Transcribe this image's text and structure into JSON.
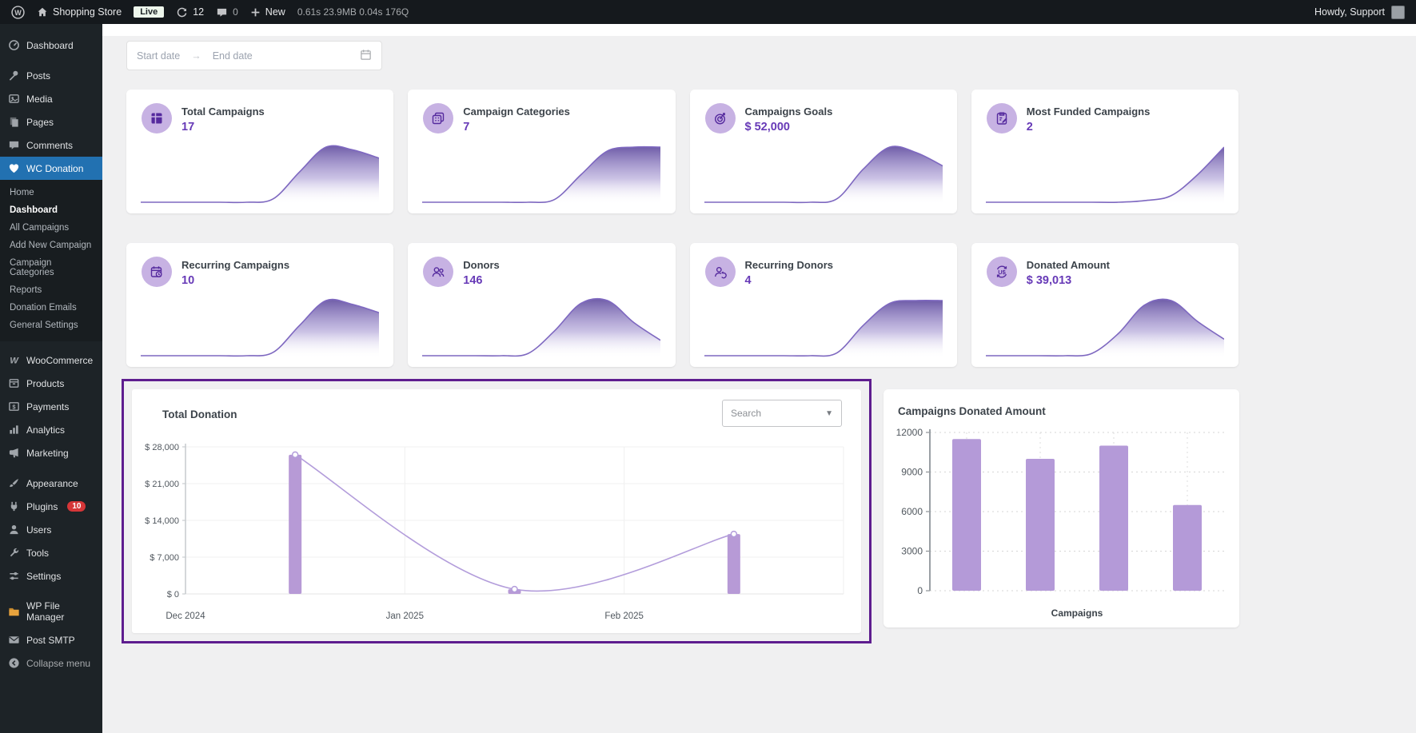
{
  "admin_bar": {
    "site_name": "Shopping Store",
    "live_badge": "Live",
    "update_count": "12",
    "comment_count": "0",
    "new_label": "New",
    "perf_stats": "0.61s 23.9MB 0.04s 176Q",
    "howdy": "Howdy, Support"
  },
  "sidebar": {
    "items": [
      {
        "label": "Dashboard"
      },
      {
        "label": "Posts"
      },
      {
        "label": "Media"
      },
      {
        "label": "Pages"
      },
      {
        "label": "Comments"
      },
      {
        "label": "WC Donation"
      },
      {
        "label": "WooCommerce"
      },
      {
        "label": "Products"
      },
      {
        "label": "Payments"
      },
      {
        "label": "Analytics"
      },
      {
        "label": "Marketing"
      },
      {
        "label": "Appearance"
      },
      {
        "label": "Plugins",
        "badge": "10"
      },
      {
        "label": "Users"
      },
      {
        "label": "Tools"
      },
      {
        "label": "Settings"
      },
      {
        "label": "WP File Manager"
      },
      {
        "label": "Post SMTP"
      },
      {
        "label": "Collapse menu"
      }
    ],
    "active_item": "WC Donation",
    "submenu": [
      "Home",
      "Dashboard",
      "All Campaigns",
      "Add New Campaign",
      "Campaign Categories",
      "Reports",
      "Donation Emails",
      "General Settings"
    ],
    "active_submenu": "Dashboard"
  },
  "date_range": {
    "start_placeholder": "Start date",
    "separator": "→",
    "end_placeholder": "End date"
  },
  "cards": [
    {
      "title": "Total Campaigns",
      "value": "17",
      "icon": "grid-icon",
      "sparkline": [
        0,
        0,
        0,
        0,
        0,
        0.06,
        0.55,
        1,
        0.95,
        0.8
      ]
    },
    {
      "title": "Campaign Categories",
      "value": "7",
      "icon": "categories-icon",
      "sparkline": [
        0,
        0,
        0,
        0,
        0,
        0.05,
        0.5,
        0.93,
        1,
        1
      ]
    },
    {
      "title": "Campaigns Goals",
      "value": "$ 52,000",
      "icon": "target-icon",
      "sparkline": [
        0,
        0,
        0,
        0,
        0,
        0.06,
        0.6,
        1,
        0.9,
        0.66
      ]
    },
    {
      "title": "Most Funded Campaigns",
      "value": "2",
      "icon": "clipboard-edit-icon",
      "sparkline": [
        0,
        0,
        0,
        0,
        0,
        0,
        0.03,
        0.12,
        0.5,
        1
      ]
    },
    {
      "title": "Recurring Campaigns",
      "value": "10",
      "icon": "calendar-clock-icon",
      "sparkline": [
        0,
        0,
        0,
        0,
        0,
        0.06,
        0.55,
        1,
        0.93,
        0.78
      ]
    },
    {
      "title": "Donors",
      "value": "146",
      "icon": "donors-icon",
      "sparkline": [
        0,
        0,
        0,
        0,
        0.04,
        0.45,
        0.95,
        1,
        0.6,
        0.28
      ]
    },
    {
      "title": "Recurring Donors",
      "value": "4",
      "icon": "recurring-donor-icon",
      "sparkline": [
        0,
        0,
        0,
        0,
        0,
        0.05,
        0.55,
        0.95,
        1,
        1
      ]
    },
    {
      "title": "Donated Amount",
      "value": "$ 39,013",
      "icon": "money-refresh-icon",
      "sparkline": [
        0,
        0,
        0,
        0,
        0.04,
        0.4,
        0.92,
        1,
        0.62,
        0.3
      ]
    }
  ],
  "chart_data": [
    {
      "type": "bar+line",
      "title": "Total Donation",
      "search_placeholder": "Search",
      "categories": [
        "Dec 2024",
        "Jan 2025",
        "Feb 2025"
      ],
      "values": [
        26500,
        900,
        11400
      ],
      "ylim": [
        0,
        28000
      ],
      "ytick_step": 7000,
      "y_prefix": "$ ",
      "grid": "light",
      "legend": "none",
      "bar_color": "#b79ad6",
      "line_color": "#b39ddb"
    },
    {
      "type": "bar",
      "title": "Campaigns Donated Amount",
      "values": [
        11500,
        10000,
        11000,
        6500
      ],
      "ylim": [
        0,
        12000
      ],
      "ytick_step": 3000,
      "xlabel": "Campaigns",
      "grid": "dashed",
      "legend": "none",
      "bar_color": "#b49ad8"
    }
  ],
  "colors": {
    "accent_purple": "#673ab7",
    "icon_circle_bg": "#c7b2e3",
    "icon_glyph": "#552a9e",
    "spark_line": "#7e68c0",
    "spark_fill_top": "#5f4b9e",
    "highlight_border": "#5e1d8f",
    "active_menu_bg": "#2271b1",
    "plugins_badge_bg": "#d63638"
  }
}
